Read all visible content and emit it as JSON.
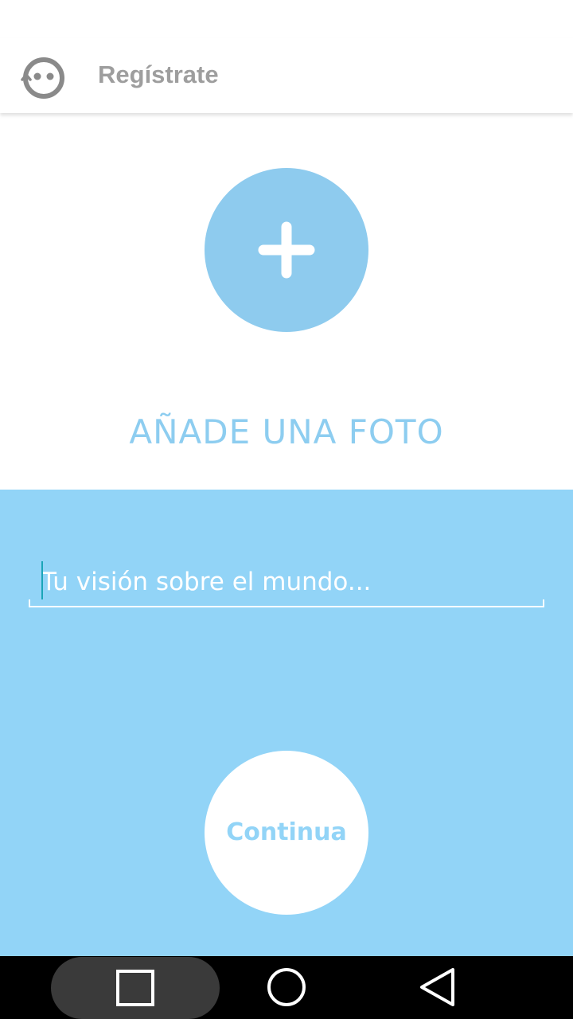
{
  "app_bar": {
    "title": "Regístrate",
    "logo_icon": "mask-face-logo-icon"
  },
  "photo": {
    "add_button_icon": "plus-icon",
    "label": "AÑADE UNA FOTO"
  },
  "bio": {
    "value": "",
    "placeholder": "Tu visión sobre el mundo..."
  },
  "continue_button": {
    "label": "Continua"
  },
  "nav_bar": {
    "recents_icon": "square-icon",
    "home_icon": "circle-icon",
    "back_icon": "triangle-back-icon"
  },
  "colors": {
    "accent_blue": "#92d4f7",
    "add_button_blue": "#8ecbee",
    "title_gray": "#9e9e9e",
    "cursor_teal": "#1aa5b8"
  }
}
